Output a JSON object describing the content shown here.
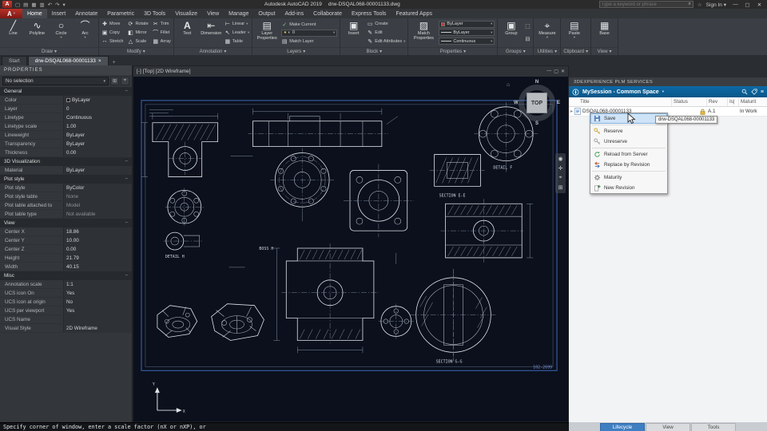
{
  "titlebar": {
    "app_title": "Autodesk AutoCAD 2019",
    "doc_title": "drw-DSQAL068-00001133.dwg",
    "search_placeholder": "Type a keyword or phrase",
    "sign_in": "Sign In"
  },
  "menu": {
    "tabs": [
      "Home",
      "Insert",
      "Annotate",
      "Parametric",
      "3D Tools",
      "Visualize",
      "View",
      "Manage",
      "Output",
      "Add-ins",
      "Collaborate",
      "Express Tools",
      "Featured Apps"
    ]
  },
  "ribbon": {
    "draw": {
      "label": "Draw",
      "line": "Line",
      "polyline": "Polyline",
      "circle": "Circle",
      "arc": "Arc"
    },
    "modify": {
      "label": "Modify",
      "items": [
        "Move",
        "Rotate",
        "Trim",
        "Copy",
        "Mirror",
        "Fillet",
        "Stretch",
        "Scale",
        "Array"
      ]
    },
    "annotation": {
      "label": "Annotation",
      "text": "Text",
      "dimension": "Dimension",
      "linear": "Linear",
      "leader": "Leader",
      "table": "Table"
    },
    "layers": {
      "label": "Layers",
      "layer_properties": "Layer Properties",
      "make_current": "Make Current",
      "match_layer": "Match Layer",
      "current_layer": "0"
    },
    "block": {
      "label": "Block",
      "insert": "Insert",
      "create": "Create",
      "edit": "Edit",
      "edit_attributes": "Edit Attributes"
    },
    "properties": {
      "label": "Properties",
      "match_properties": "Match Properties",
      "color": "ByLayer",
      "lineweight": "ByLayer",
      "linetype": "Continuous"
    },
    "groups": {
      "label": "Groups",
      "group": "Group"
    },
    "utilities": {
      "label": "Utilities",
      "measure": "Measure"
    },
    "clipboard": {
      "label": "Clipboard",
      "paste": "Paste"
    },
    "view": {
      "label": "View",
      "base": "Base"
    }
  },
  "doc_tabs": {
    "start": "Start",
    "doc": "drw-DSQAL068-00001133"
  },
  "palette": {
    "title": "PROPERTIES",
    "selection": "No selection",
    "general": {
      "title": "General",
      "rows": [
        {
          "k": "Color",
          "v": "ByLayer"
        },
        {
          "k": "Layer",
          "v": "0"
        },
        {
          "k": "Linetype",
          "v": "Continuous"
        },
        {
          "k": "Linetype scale",
          "v": "1.00"
        },
        {
          "k": "Lineweight",
          "v": "ByLayer"
        },
        {
          "k": "Transparency",
          "v": "ByLayer"
        },
        {
          "k": "Thickness",
          "v": "0.00"
        }
      ]
    },
    "viz": {
      "title": "3D Visualization",
      "rows": [
        {
          "k": "Material",
          "v": "ByLayer"
        }
      ]
    },
    "plot": {
      "title": "Plot style",
      "rows": [
        {
          "k": "Plot style",
          "v": "ByColor"
        },
        {
          "k": "Plot style table",
          "v": "None"
        },
        {
          "k": "Plot table attached to",
          "v": "Model"
        },
        {
          "k": "Plot table type",
          "v": "Not available"
        }
      ]
    },
    "view": {
      "title": "View",
      "rows": [
        {
          "k": "Center X",
          "v": "18.86"
        },
        {
          "k": "Center Y",
          "v": "10.00"
        },
        {
          "k": "Center Z",
          "v": "0.00"
        },
        {
          "k": "Height",
          "v": "21.79"
        },
        {
          "k": "Width",
          "v": "40.15"
        }
      ]
    },
    "misc": {
      "title": "Misc",
      "rows": [
        {
          "k": "Annotation scale",
          "v": "1:1"
        },
        {
          "k": "UCS icon On",
          "v": "Yes"
        },
        {
          "k": "UCS icon at origin",
          "v": "No"
        },
        {
          "k": "UCS per viewport",
          "v": "Yes"
        },
        {
          "k": "UCS Name",
          "v": ""
        },
        {
          "k": "Visual Style",
          "v": "2D Wireframe"
        }
      ]
    }
  },
  "viewport": {
    "minimized": "[-]",
    "view": "[Top]",
    "visual_style": "[2D Wireframe]"
  },
  "viewcube": {
    "top": "TOP",
    "n": "N",
    "e": "E",
    "w": "W",
    "s": "S"
  },
  "canvas": {
    "labels": {
      "section_ee": "SECTION E-E",
      "section_gg": "SECTION G-G",
      "detail_f": "DETAIL F",
      "detail_h": "DETAIL H",
      "boss_h": "BOSS H",
      "frame_no": "102-2699",
      "ucs_x": "X",
      "ucs_y": "Y"
    }
  },
  "command_line": {
    "prompt": "Specify corner of window, enter a scale factor (nX or nXP), or"
  },
  "plm": {
    "window_title": "3DEXPERIENCE PLM SERVICES",
    "session": "MySession - Common Space",
    "columns": {
      "title": "Title",
      "status": "Status",
      "rev": "Rev",
      "is": "Is|",
      "maturity": "Maturit"
    },
    "row": {
      "title": "DSQAL068-00001133",
      "rev": "A.1",
      "maturity": "In Work"
    },
    "menu": {
      "save": "Save",
      "reserve": "Reserve",
      "unreserve": "Unreserve",
      "reload": "Reload from Server",
      "replace": "Replace by Revision",
      "maturity": "Maturity",
      "new_revision": "New Revision"
    },
    "tooltip": "drw-DSQAL068-00001133",
    "tabs": {
      "lifecycle": "Lifecycle",
      "view": "View",
      "tools": "Tools"
    }
  },
  "colors": {
    "accent_blue": "#0d6aa8",
    "highlight": "#cfe3f7",
    "frame_blue": "#3f68b8",
    "active_tab": "#3f7fc1"
  }
}
